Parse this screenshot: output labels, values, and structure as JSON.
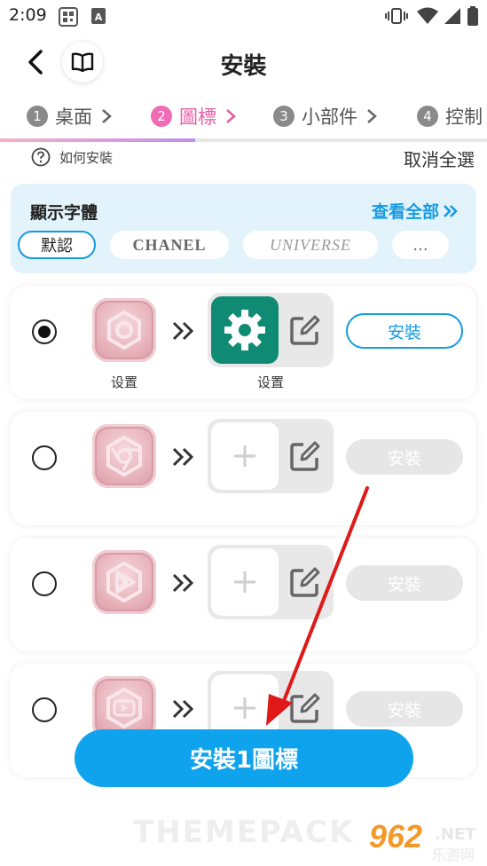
{
  "status_bar": {
    "time": "2:09"
  },
  "header": {
    "title": "安裝"
  },
  "steps": [
    {
      "num": "1",
      "label": "桌面"
    },
    {
      "num": "2",
      "label": "圖標"
    },
    {
      "num": "3",
      "label": "小部件"
    },
    {
      "num": "4",
      "label": "控制"
    }
  ],
  "progress": {
    "fraction": 0.4
  },
  "help": {
    "label": "如何安裝",
    "deselect_all": "取消全選"
  },
  "font_panel": {
    "title": "顯示字體",
    "view_all": "查看全部",
    "chips": [
      "默認",
      "CHANEL",
      "UNIVERSE",
      "..."
    ]
  },
  "rows": [
    {
      "selected": true,
      "source_caption": "设置",
      "target_caption": "设置",
      "install_label": "安裝",
      "state": "active"
    },
    {
      "selected": false,
      "install_label": "安裝",
      "state": "disabled"
    },
    {
      "selected": false,
      "install_label": "安裝",
      "state": "disabled"
    },
    {
      "selected": false,
      "install_label": "安裝",
      "state": "disabled"
    }
  ],
  "install_button": {
    "label": "安裝1圖標"
  },
  "watermark": {
    "brand": "THEMEPACK",
    "site_number": "962",
    "site_tld": ".NET",
    "site_cn": "乐游网"
  },
  "colors": {
    "accent": "#0fa3ee",
    "active_step": "#e45fa6",
    "settings_tile": "#0f8b74"
  }
}
